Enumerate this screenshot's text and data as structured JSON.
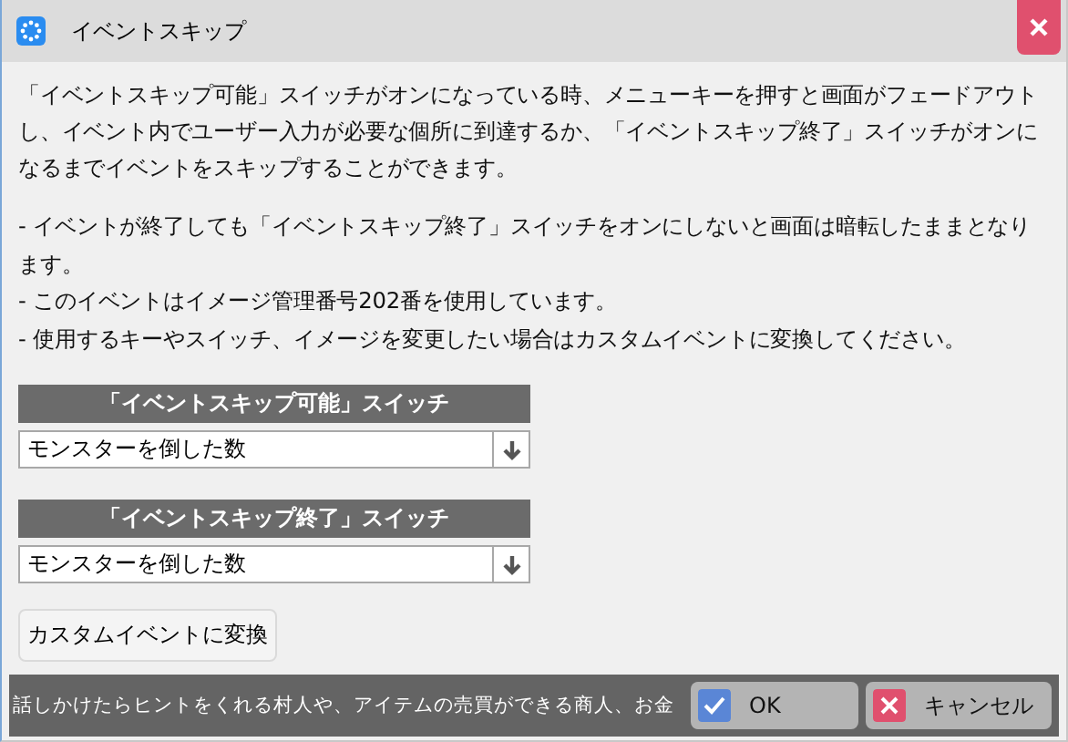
{
  "window": {
    "title": "イベントスキップ"
  },
  "description": "「イベントスキップ可能」スイッチがオンになっている時、メニューキーを押すと画面がフェードアウトし、イベント内でユーザー入力が必要な個所に到達するか、「イベントスキップ終了」スイッチがオンになるまでイベントをスキップすることができます。",
  "notes": [
    "- イベントが終了しても「イベントスキップ終了」スイッチをオンにしないと画面は暗転したままとなります。",
    "- このイベントはイメージ管理番号202番を使用しています。",
    "- 使用するキーやスイッチ、イメージを変更したい場合はカスタムイベントに変換してください。"
  ],
  "switches": [
    {
      "header": "「イベントスキップ可能」スイッチ",
      "value": "モンスターを倒した数"
    },
    {
      "header": "「イベントスキップ終了」スイッチ",
      "value": "モンスターを倒した数"
    }
  ],
  "convert_button": "カスタムイベントに変換",
  "status_bar": {
    "hint": "話しかけたらヒントをくれる村人や、アイテムの売買ができる商人、お金"
  },
  "buttons": [
    {
      "kind": "ok",
      "label": "OK"
    },
    {
      "kind": "cancel",
      "label": "キャンセル"
    }
  ]
}
